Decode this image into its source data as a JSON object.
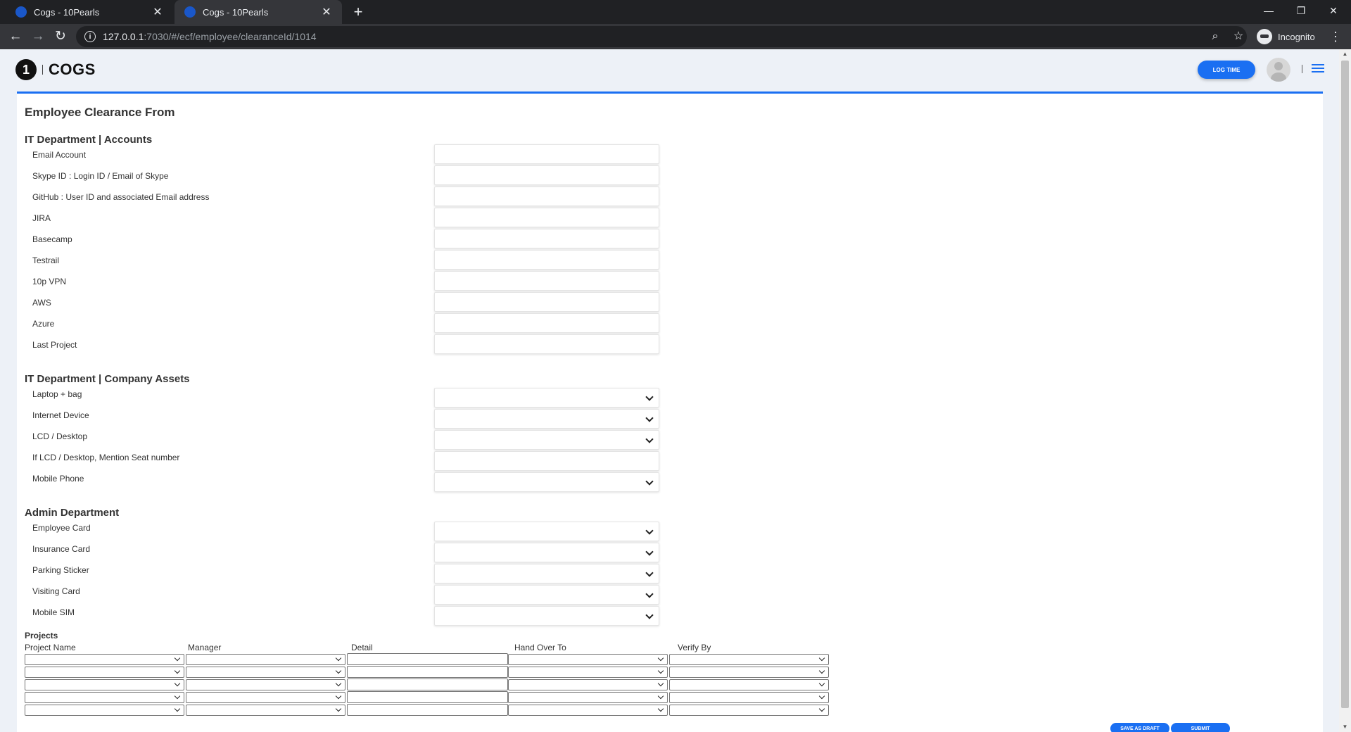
{
  "browser": {
    "tabs": [
      {
        "title": "Cogs - 10Pearls"
      },
      {
        "title": "Cogs - 10Pearls"
      }
    ],
    "url_host": "127.0.0.1",
    "url_path": ":7030/#/ecf/employee/clearanceId/1014",
    "incognito_label": "Incognito"
  },
  "header": {
    "logo_mark": "1",
    "logo_word": "COGS",
    "log_time_label": "LOG TIME"
  },
  "form": {
    "title": "Employee Clearance From",
    "sections": {
      "it_accounts": {
        "title": "IT Department | Accounts",
        "items": [
          "Email Account",
          "Skype ID : Login ID / Email of Skype",
          "GitHub : User ID and associated Email address",
          "JIRA",
          "Basecamp",
          "Testrail",
          "10p VPN",
          "AWS",
          "Azure",
          "Last Project"
        ]
      },
      "it_assets": {
        "title": "IT Department | Company Assets",
        "items": [
          "Laptop + bag",
          "Internet Device",
          "LCD / Desktop",
          "If LCD / Desktop, Mention Seat number",
          "Mobile Phone"
        ]
      },
      "admin": {
        "title": "Admin Department",
        "items": [
          "Employee Card",
          "Insurance Card",
          "Parking Sticker",
          "Visiting Card",
          "Mobile SIM"
        ]
      }
    },
    "projects": {
      "title": "Projects",
      "columns": [
        "Project Name",
        "Manager",
        "Detail",
        "Hand Over To",
        "Verify By"
      ]
    },
    "buttons": {
      "save_draft": "SAVE AS DRAFT",
      "submit": "SUBMIT"
    }
  }
}
